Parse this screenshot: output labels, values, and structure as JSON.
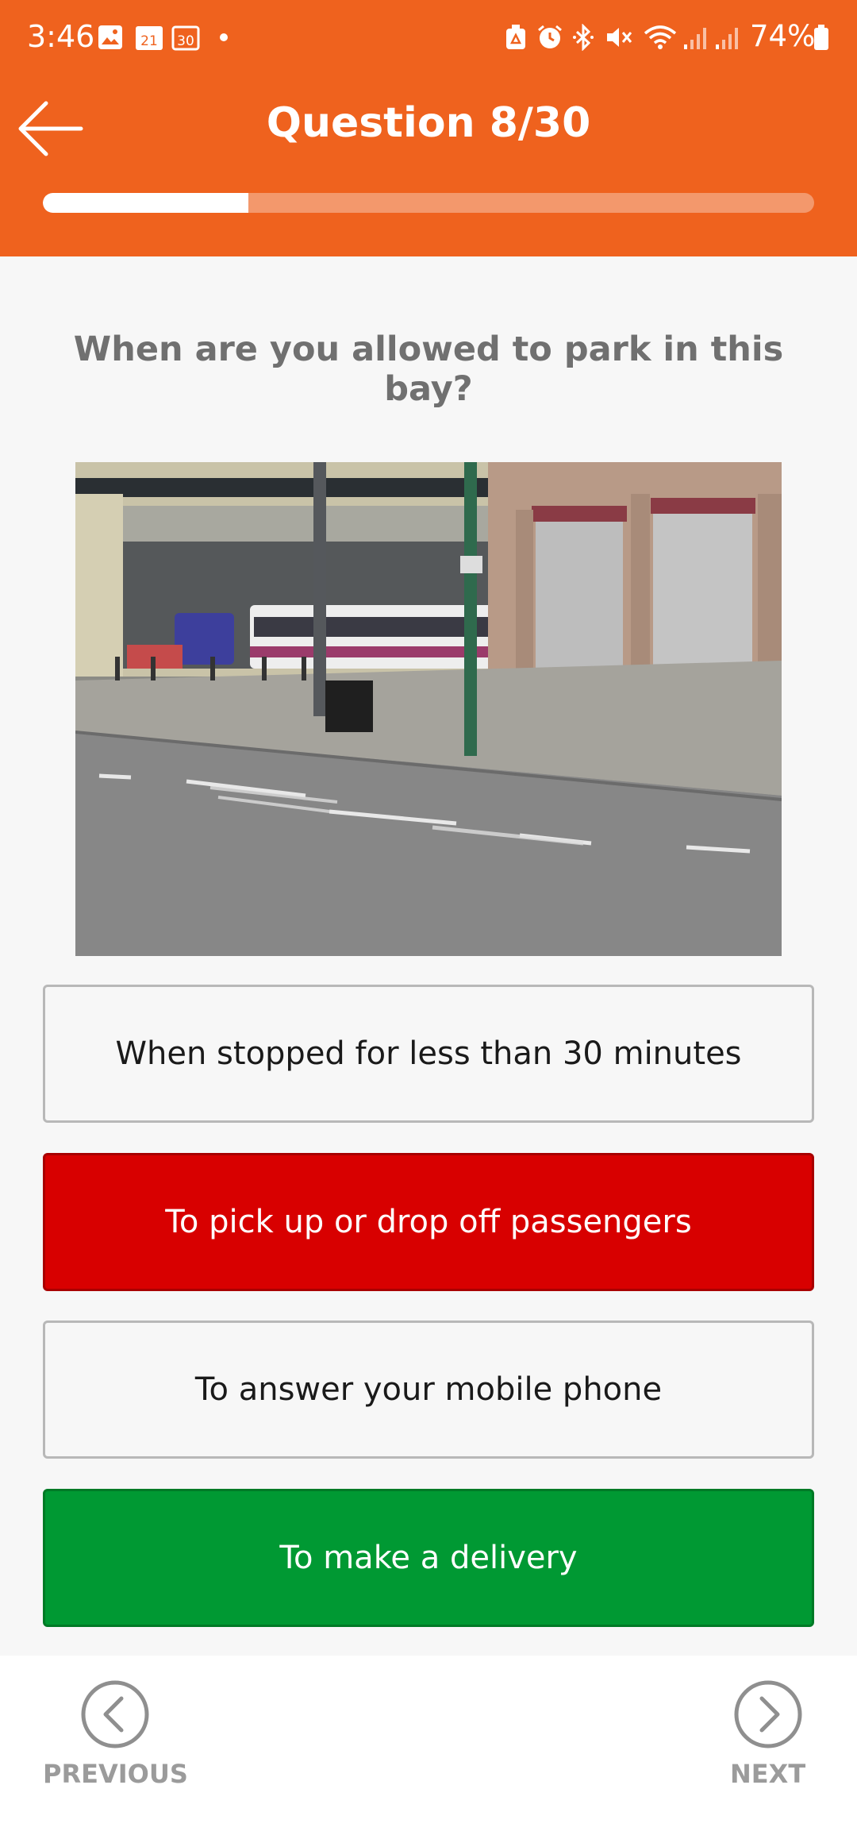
{
  "status_bar": {
    "time": "3:46",
    "battery": "74%",
    "calendar_day_1": "21",
    "calendar_day_2": "30"
  },
  "header": {
    "title": "Question 8/30",
    "progress_fraction": 0.2667,
    "accent_color": "#ef621e"
  },
  "question": {
    "text": "When are you allowed to park in this bay?"
  },
  "options": [
    {
      "label": "When stopped for less than 30 minutes",
      "state": "neutral"
    },
    {
      "label": "To pick up or drop off passengers",
      "state": "wrong",
      "color": "#d80000"
    },
    {
      "label": "To answer your mobile phone",
      "state": "neutral"
    },
    {
      "label": "To make a delivery",
      "state": "correct",
      "color": "#009933"
    }
  ],
  "navigation": {
    "previous_label": "PREVIOUS",
    "next_label": "NEXT"
  }
}
